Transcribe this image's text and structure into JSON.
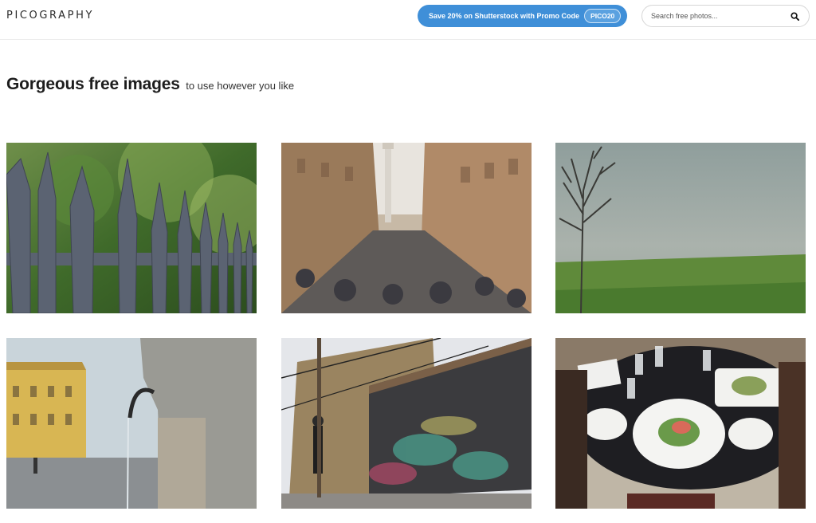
{
  "header": {
    "logo": "PICOGRAPHY",
    "promo_text": "Save 20% on Shutterstock with Promo Code",
    "promo_code": "PICO20",
    "search_placeholder": "Search free photos...",
    "search_icon": "search-icon"
  },
  "hero": {
    "title": "Gorgeous free images",
    "subtitle": "to use however you like"
  },
  "photos": [
    {
      "subject": "iron fence spikes with green foliage"
    },
    {
      "subject": "narrow city street with column and crowd"
    },
    {
      "subject": "bare tree in foggy green field"
    },
    {
      "subject": "fountain spout with yellow building square"
    },
    {
      "subject": "graffiti covered building with runner"
    },
    {
      "subject": "restaurant table with plated dinner"
    }
  ],
  "colors": {
    "accent": "#3f8fd8",
    "text": "#1d1d1d",
    "border": "#d6d6d6"
  }
}
